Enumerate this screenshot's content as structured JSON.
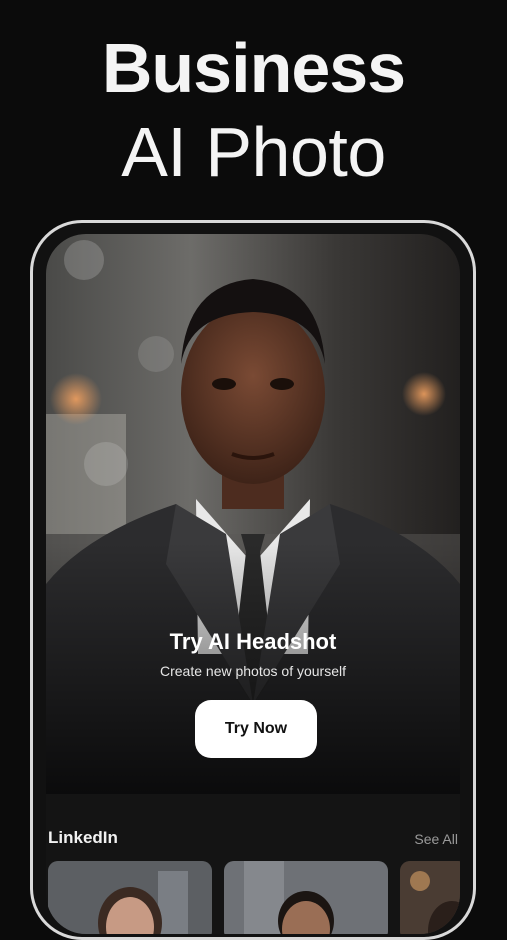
{
  "headline": {
    "line1": "Business",
    "line2": "AI Photo"
  },
  "hero": {
    "title": "Try AI Headshot",
    "subtitle": "Create new photos of yourself",
    "button_label": "Try Now"
  },
  "section": {
    "title": "LinkedIn",
    "see_all_label": "See All"
  },
  "thumbnails": [
    {
      "name": "linkedin-photo-1"
    },
    {
      "name": "linkedin-photo-2"
    },
    {
      "name": "linkedin-photo-3"
    }
  ],
  "colors": {
    "background": "#0b0b0b",
    "phone_frame": "#d9d9d9",
    "button": "#ffffff",
    "see_all": "#9a9a9a"
  }
}
